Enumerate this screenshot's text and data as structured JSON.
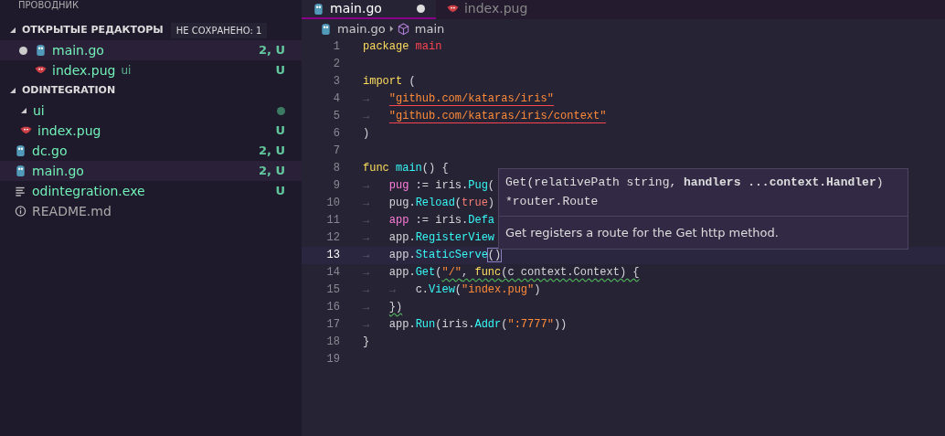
{
  "sidebar": {
    "title": "ПРОВОДНИК",
    "sections": [
      {
        "label": "ОТКРЫТЫЕ РЕДАКТОРЫ",
        "badge": "НЕ СОХРАНЕНО: 1",
        "expanded": true,
        "items": [
          {
            "name": "main.go",
            "kind": "go",
            "unsaved": true,
            "status": "2, U",
            "untracked": true,
            "selected": true
          },
          {
            "name": "index.pug",
            "kind": "pug",
            "detail": "ui",
            "unsaved": false,
            "status": "U",
            "untracked": true,
            "selected": false
          }
        ]
      },
      {
        "label": "ODINTEGRATION",
        "expanded": true,
        "items": [
          {
            "name": "ui",
            "kind": "folder",
            "expanded": true,
            "changes_dot": true,
            "untracked": true,
            "selected": false,
            "children": [
              {
                "name": "index.pug",
                "kind": "pug",
                "status": "U",
                "untracked": true,
                "selected": false
              }
            ]
          },
          {
            "name": "dc.go",
            "kind": "go",
            "status": "2, U",
            "untracked": true,
            "selected": false
          },
          {
            "name": "main.go",
            "kind": "go",
            "status": "2, U",
            "untracked": true,
            "selected": true
          },
          {
            "name": "odintegration.exe",
            "kind": "exe",
            "status": "U",
            "untracked": true,
            "selected": false
          },
          {
            "name": "README.md",
            "kind": "info",
            "untracked": false,
            "selected": false
          }
        ]
      }
    ]
  },
  "tabs": [
    {
      "label": "main.go",
      "kind": "go",
      "selected": true,
      "unsaved": true
    },
    {
      "label": "index.pug",
      "kind": "pug",
      "selected": false,
      "unsaved": false
    }
  ],
  "breadcrumb": [
    {
      "label": "main.go",
      "kind": "go"
    },
    {
      "label": "main",
      "kind": "symbol"
    }
  ],
  "editor": {
    "lines": [
      {
        "number": "1",
        "current": false,
        "tokens": [
          {
            "kind": "kw",
            "text": "package "
          },
          {
            "kind": "pkg",
            "text": "main"
          }
        ]
      },
      {
        "number": "2",
        "current": false
      },
      {
        "number": "3",
        "current": false,
        "tokens": [
          {
            "kind": "kw",
            "text": "import"
          },
          {
            "kind": "plain",
            "text": " ("
          }
        ]
      },
      {
        "number": "4",
        "current": false,
        "tokens": [
          {
            "kind": "ws",
            "text": "→   "
          },
          {
            "kind": "str",
            "text": "\"github.com/kataras/iris\"",
            "error": true
          }
        ]
      },
      {
        "number": "5",
        "current": false,
        "tokens": [
          {
            "kind": "ws",
            "text": "→   "
          },
          {
            "kind": "str",
            "text": "\"github.com/kataras/iris/context\"",
            "error": true
          }
        ]
      },
      {
        "number": "6",
        "current": false,
        "tokens": [
          {
            "kind": "plain",
            "text": ")"
          }
        ]
      },
      {
        "number": "7",
        "current": false
      },
      {
        "number": "8",
        "current": false,
        "tokens": [
          {
            "kind": "kw",
            "text": "func "
          },
          {
            "kind": "fn",
            "text": "main"
          },
          {
            "kind": "plain",
            "text": "() {"
          }
        ]
      },
      {
        "number": "9",
        "current": false,
        "tokens": [
          {
            "kind": "ws",
            "text": "→   "
          },
          {
            "kind": "var",
            "text": "pug"
          },
          {
            "kind": "plain",
            "text": " := iris."
          },
          {
            "kind": "fn",
            "text": "Pug"
          },
          {
            "kind": "plain",
            "text": "("
          }
        ]
      },
      {
        "number": "10",
        "current": false,
        "tokens": [
          {
            "kind": "ws",
            "text": "→   "
          },
          {
            "kind": "plain",
            "text": "pug."
          },
          {
            "kind": "fn",
            "text": "Reload"
          },
          {
            "kind": "plain",
            "text": "("
          },
          {
            "kind": "lit",
            "text": "true"
          },
          {
            "kind": "plain",
            "text": ")"
          }
        ]
      },
      {
        "number": "11",
        "current": false,
        "tokens": [
          {
            "kind": "ws",
            "text": "→   "
          },
          {
            "kind": "var",
            "text": "app"
          },
          {
            "kind": "plain",
            "text": " := iris."
          },
          {
            "kind": "fn",
            "text": "Defa"
          }
        ]
      },
      {
        "number": "12",
        "current": false,
        "tokens": [
          {
            "kind": "ws",
            "text": "→   "
          },
          {
            "kind": "plain",
            "text": "app."
          },
          {
            "kind": "fn",
            "text": "RegisterView"
          }
        ]
      },
      {
        "number": "13",
        "current": true,
        "tokens": [
          {
            "kind": "ws",
            "text": "→   "
          },
          {
            "kind": "plain",
            "text": "app."
          },
          {
            "kind": "fn",
            "text": "StaticServe"
          },
          {
            "kind": "match",
            "text": "()"
          }
        ]
      },
      {
        "number": "14",
        "current": false,
        "tokens": [
          {
            "kind": "ws",
            "text": "→   "
          },
          {
            "kind": "plain",
            "text": "app."
          },
          {
            "kind": "fn",
            "text": "Get"
          },
          {
            "kind": "plain",
            "text": "("
          },
          {
            "kind": "str",
            "text": "\"/\"",
            "warning": true
          },
          {
            "kind": "plain",
            "text": ", ",
            "warning": true
          },
          {
            "kind": "kw",
            "text": "func",
            "warning": true
          },
          {
            "kind": "plain",
            "text": "(c context.Context) {",
            "warning": true
          }
        ]
      },
      {
        "number": "15",
        "current": false,
        "tokens": [
          {
            "kind": "ws",
            "text": "→   "
          },
          {
            "kind": "ws",
            "text": "→   "
          },
          {
            "kind": "plain",
            "text": "c."
          },
          {
            "kind": "fn",
            "text": "View"
          },
          {
            "kind": "plain",
            "text": "("
          },
          {
            "kind": "str",
            "text": "\"index.pug\""
          },
          {
            "kind": "plain",
            "text": ")"
          }
        ]
      },
      {
        "number": "16",
        "current": false,
        "tokens": [
          {
            "kind": "ws",
            "text": "→   "
          },
          {
            "kind": "plain",
            "text": "})",
            "warning": true
          }
        ]
      },
      {
        "number": "17",
        "current": false,
        "tokens": [
          {
            "kind": "ws",
            "text": "→   "
          },
          {
            "kind": "plain",
            "text": "app."
          },
          {
            "kind": "fn",
            "text": "Run"
          },
          {
            "kind": "plain",
            "text": "(iris."
          },
          {
            "kind": "fn",
            "text": "Addr"
          },
          {
            "kind": "plain",
            "text": "("
          },
          {
            "kind": "str",
            "text": "\":7777\""
          },
          {
            "kind": "plain",
            "text": "))"
          }
        ]
      },
      {
        "number": "18",
        "current": false,
        "tokens": [
          {
            "kind": "plain",
            "text": "}"
          }
        ]
      },
      {
        "number": "19",
        "current": false
      }
    ]
  },
  "hover": {
    "signature": "Get(relativePath string, **handlers ...context.Handler**)",
    "returns": "*router.Route",
    "description": "Get registers a route for the Get http method."
  }
}
